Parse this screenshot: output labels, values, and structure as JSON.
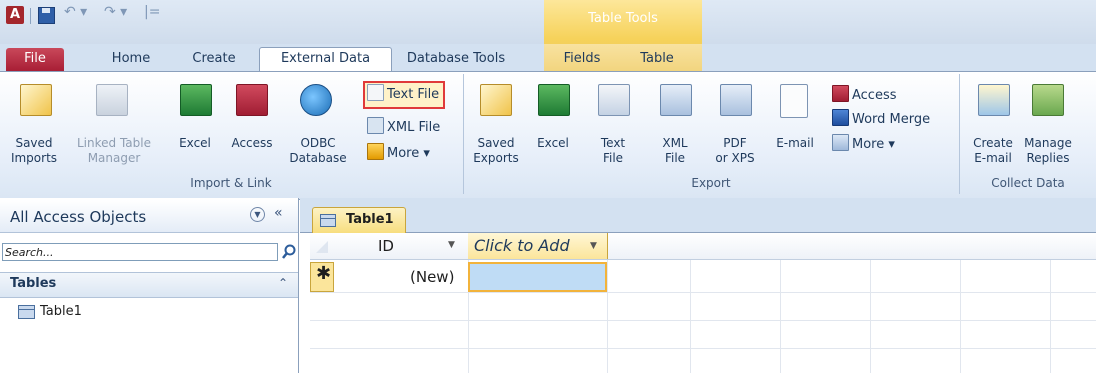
{
  "app": {
    "logo_letter": "A"
  },
  "qat": {
    "customize_glyph": "|="
  },
  "contextual": {
    "label": "Table Tools",
    "tabs": [
      "Fields",
      "Table"
    ]
  },
  "tabs": [
    "File",
    "Home",
    "Create",
    "External Data",
    "Database Tools"
  ],
  "ribbon": {
    "import": {
      "group_label": "Import & Link",
      "saved_imports": [
        "Saved",
        "Imports"
      ],
      "linked_table_manager": [
        "Linked Table",
        "Manager"
      ],
      "excel": "Excel",
      "access": "Access",
      "odbc": [
        "ODBC",
        "Database"
      ],
      "text_file": "Text File",
      "xml_file": "XML File",
      "more": "More ▾"
    },
    "export": {
      "group_label": "Export",
      "saved_exports": [
        "Saved",
        "Exports"
      ],
      "excel": "Excel",
      "text_file": [
        "Text",
        "File"
      ],
      "xml_file": [
        "XML",
        "File"
      ],
      "pdf": [
        "PDF",
        "or XPS"
      ],
      "email": "E-mail",
      "access": "Access",
      "word_merge": "Word Merge",
      "more": "More ▾"
    },
    "collect": {
      "group_label": "Collect Data",
      "create_email": [
        "Create",
        "E-mail"
      ],
      "manage_replies": [
        "Manage",
        "Replies"
      ]
    }
  },
  "nav": {
    "title": "All Access Objects",
    "search_placeholder": "Search...",
    "section": "Tables",
    "items": [
      "Table1"
    ]
  },
  "document": {
    "tab": "Table1",
    "columns": [
      "ID",
      "Click to Add"
    ],
    "new_row_marker": "✱",
    "new_row_value": "(New)"
  }
}
